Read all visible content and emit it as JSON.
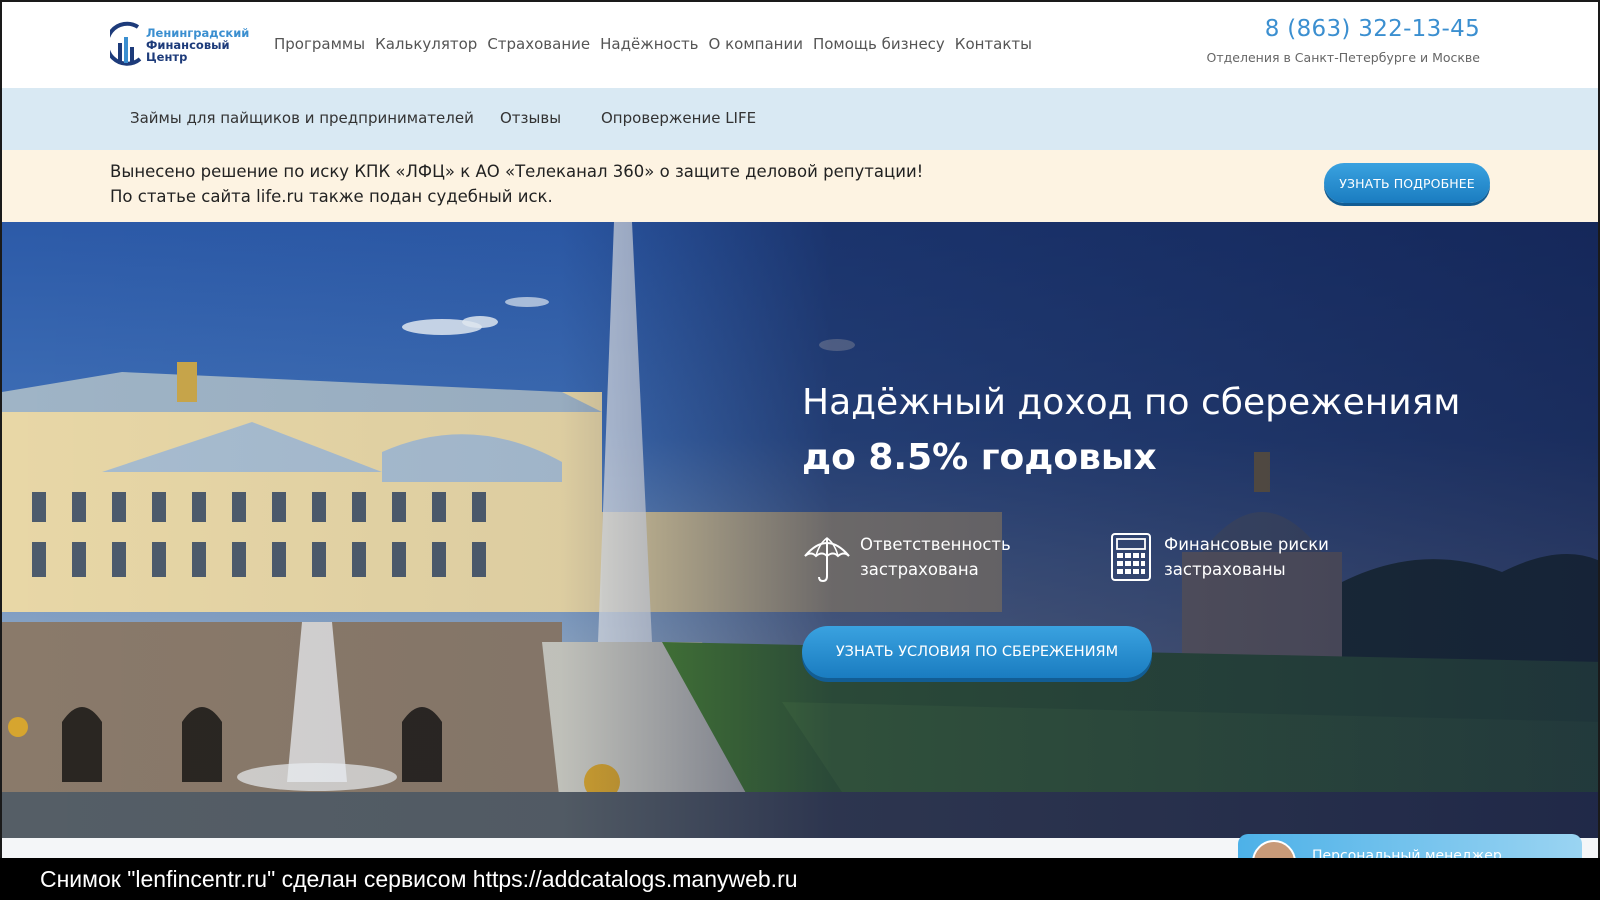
{
  "header": {
    "logo": {
      "line1": "Ленинградский",
      "line2": "Финансовый",
      "line3": "Центр",
      "icon": "lfc-logo-icon"
    },
    "nav": [
      "Программы",
      "Калькулятор",
      "Страхование",
      "Надёжность",
      "О компании",
      "Помощь бизнесу",
      "Контакты"
    ],
    "phone": "8 (863) 322-13-45",
    "branches": "Отделения в Санкт-Петербурге и Москве"
  },
  "subnav": [
    "Займы для пайщиков и предпринимателей",
    "Отзывы",
    "Опровержение LIFE"
  ],
  "notice": {
    "line1": "Вынесено решение по иску КПК «ЛФЦ» к АО «Телеканал 360» о защите деловой репутации!",
    "line2": "По статье сайта life.ru также подан судебный иск.",
    "button": "УЗНАТЬ ПОДРОБНЕЕ"
  },
  "hero": {
    "title1": "Надёжный доход по сбережениям",
    "title2": "до 8.5% годовых",
    "features": [
      {
        "icon": "umbrella-icon",
        "line1": "Ответственность",
        "line2": "застрахована"
      },
      {
        "icon": "calculator-icon",
        "line1": "Финансовые риски",
        "line2": "застрахованы"
      }
    ],
    "button": "УЗНАТЬ УСЛОВИЯ ПО СБЕРЕЖЕНИЯМ"
  },
  "manager_widget": {
    "label": "Персональный менеджер"
  },
  "caption": "Снимок \"lenfincentr.ru\" сделан сервисом https://addcatalogs.manyweb.ru",
  "colors": {
    "accent": "#3b8fd0",
    "button": "#1a7cc0",
    "subnav_bg": "#d9e9f3",
    "notice_bg": "#fdf3e2"
  }
}
